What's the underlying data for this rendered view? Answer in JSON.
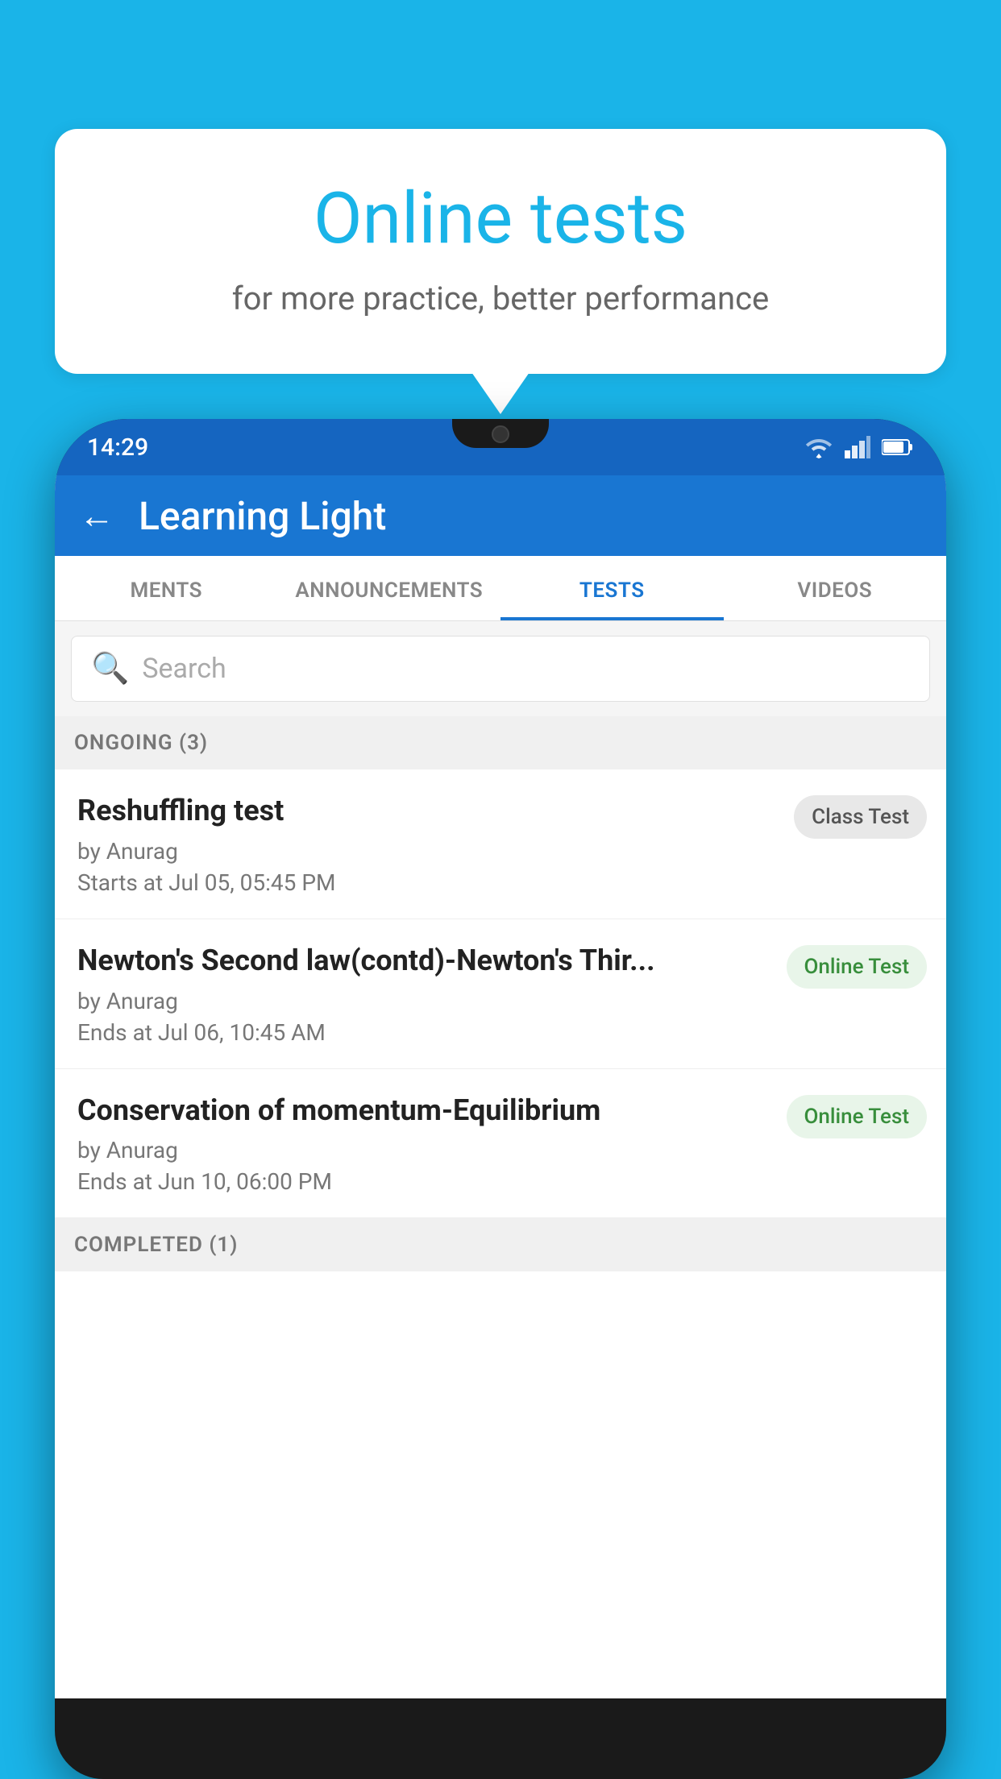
{
  "background_color": "#1ab4e8",
  "speech_bubble": {
    "title": "Online tests",
    "subtitle": "for more practice, better performance"
  },
  "phone": {
    "status_bar": {
      "time": "14:29",
      "icons": [
        "wifi",
        "signal",
        "battery"
      ]
    },
    "app_bar": {
      "title": "Learning Light",
      "back_button_label": "←"
    },
    "tabs": [
      {
        "label": "MENTS",
        "active": false
      },
      {
        "label": "ANNOUNCEMENTS",
        "active": false
      },
      {
        "label": "TESTS",
        "active": true
      },
      {
        "label": "VIDEOS",
        "active": false
      }
    ],
    "search": {
      "placeholder": "Search"
    },
    "sections": [
      {
        "header": "ONGOING (3)",
        "items": [
          {
            "title": "Reshuffling test",
            "author": "by Anurag",
            "date": "Starts at  Jul 05, 05:45 PM",
            "badge": "Class Test",
            "badge_type": "class"
          },
          {
            "title": "Newton's Second law(contd)-Newton's Thir...",
            "author": "by Anurag",
            "date": "Ends at  Jul 06, 10:45 AM",
            "badge": "Online Test",
            "badge_type": "online"
          },
          {
            "title": "Conservation of momentum-Equilibrium",
            "author": "by Anurag",
            "date": "Ends at  Jun 10, 06:00 PM",
            "badge": "Online Test",
            "badge_type": "online"
          }
        ]
      },
      {
        "header": "COMPLETED (1)",
        "items": []
      }
    ]
  }
}
